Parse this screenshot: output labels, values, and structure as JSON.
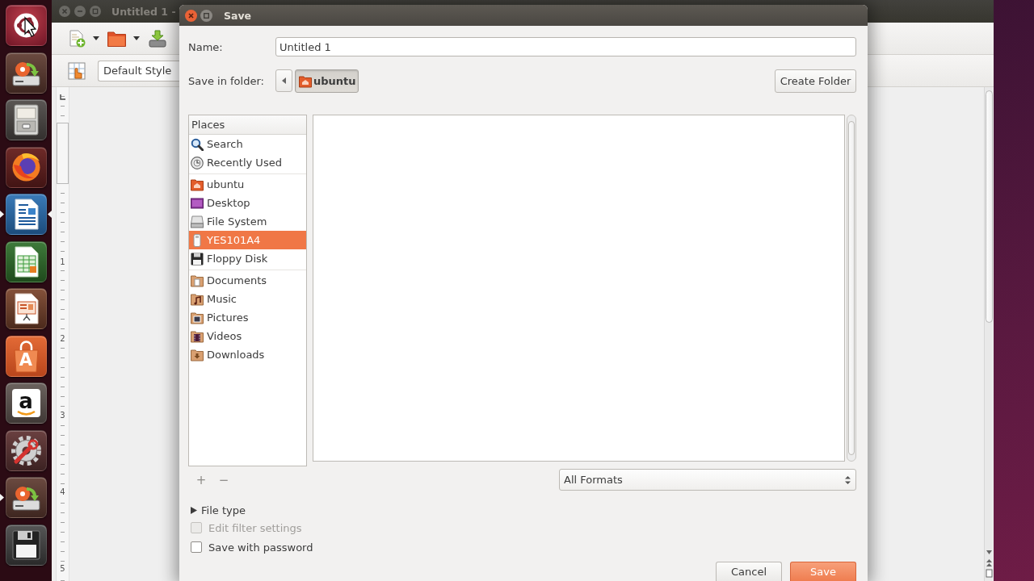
{
  "launcher": {
    "items": [
      {
        "kind": "dash",
        "running": false,
        "focused": false
      },
      {
        "kind": "installer",
        "running": false,
        "focused": false
      },
      {
        "kind": "files",
        "running": false,
        "focused": false
      },
      {
        "kind": "browser",
        "running": false,
        "focused": false
      },
      {
        "kind": "writer",
        "running": true,
        "focused": true
      },
      {
        "kind": "calc",
        "running": false,
        "focused": false
      },
      {
        "kind": "impress",
        "running": false,
        "focused": false
      },
      {
        "kind": "store",
        "glyph": "A",
        "running": false,
        "focused": false
      },
      {
        "kind": "shop",
        "glyph": "a",
        "running": false,
        "focused": false
      },
      {
        "kind": "settings",
        "running": false,
        "focused": false
      },
      {
        "kind": "installer",
        "running": true,
        "focused": false
      },
      {
        "kind": "floppy",
        "running": false,
        "focused": false
      }
    ]
  },
  "writer": {
    "title": "Untitled 1 -",
    "style_box": "Default Style",
    "ruler_numbers": [
      "1",
      "2",
      "3",
      "4",
      "5"
    ]
  },
  "dialog": {
    "title": "Save",
    "name": {
      "label": "Name:",
      "value": "Untitled 1"
    },
    "folder": {
      "label": "Save in folder:",
      "path": [
        {
          "label": "ubuntu",
          "selected": true
        }
      ]
    },
    "create_folder": "Create Folder",
    "places": {
      "header": "Places",
      "sections": [
        {
          "items": [
            {
              "kind": "search",
              "label": "Search",
              "selected": false
            },
            {
              "kind": "recent",
              "label": "Recently Used",
              "selected": false
            }
          ]
        },
        {
          "items": [
            {
              "kind": "home",
              "label": "ubuntu",
              "selected": false
            },
            {
              "kind": "desktop",
              "label": "Desktop",
              "selected": false
            },
            {
              "kind": "filesystem",
              "label": "File System",
              "selected": false
            },
            {
              "kind": "usb",
              "label": "YES101A4",
              "selected": true
            },
            {
              "kind": "floppy",
              "label": "Floppy Disk",
              "selected": false
            }
          ]
        },
        {
          "items": [
            {
              "kind": "documents",
              "label": "Documents",
              "selected": false
            },
            {
              "kind": "music",
              "label": "Music",
              "selected": false
            },
            {
              "kind": "pictures",
              "label": "Pictures",
              "selected": false
            },
            {
              "kind": "videos",
              "label": "Videos",
              "selected": false
            },
            {
              "kind": "downloads",
              "label": "Downloads",
              "selected": false
            }
          ]
        }
      ]
    },
    "bookmark_buttons": [
      {
        "label": "+",
        "disabled": true
      },
      {
        "label": "−",
        "disabled": true
      }
    ],
    "filter": "All Formats",
    "expander": {
      "label": "File type",
      "expanded": false
    },
    "options": [
      {
        "label": "Edit filter settings",
        "checked": false,
        "disabled": true
      },
      {
        "label": "Save with password",
        "checked": false,
        "disabled": false
      }
    ],
    "buttons": [
      {
        "label": "Cancel",
        "kind": "normal"
      },
      {
        "label": "Save",
        "kind": "suggested"
      }
    ]
  }
}
